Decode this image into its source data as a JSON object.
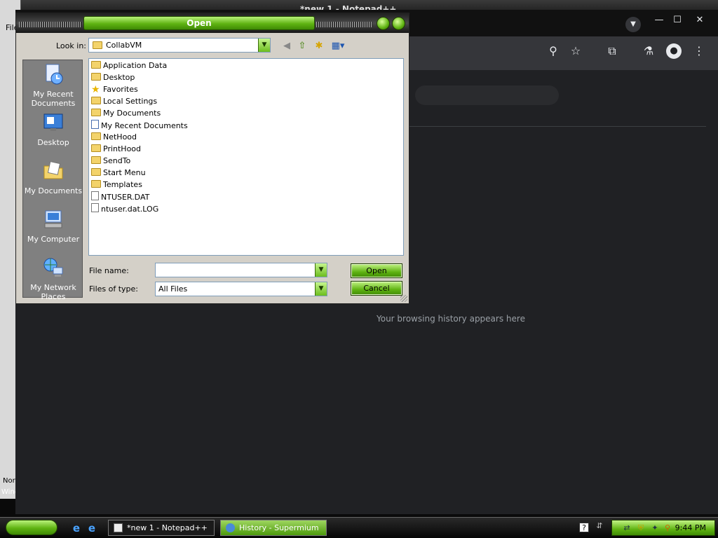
{
  "notepad": {
    "title": "*new 1 - Notepad++",
    "menu_label": "File",
    "status_left": "Nor",
    "status_left2": "Wind"
  },
  "browser": {
    "empty_history_text": "Your browsing history appears here"
  },
  "dialog": {
    "title": "Open",
    "look_in_label": "Look in:",
    "look_in_value": "CollabVM",
    "places": [
      {
        "label": "My Recent Documents"
      },
      {
        "label": "Desktop"
      },
      {
        "label": "My Documents"
      },
      {
        "label": "My Computer"
      },
      {
        "label": "My Network Places"
      }
    ],
    "files": [
      {
        "name": "Application Data",
        "type": "folder"
      },
      {
        "name": "Desktop",
        "type": "folder"
      },
      {
        "name": "Favorites",
        "type": "favorites"
      },
      {
        "name": "Local Settings",
        "type": "folder"
      },
      {
        "name": "My Documents",
        "type": "folder"
      },
      {
        "name": "My Recent Documents",
        "type": "recent"
      },
      {
        "name": "NetHood",
        "type": "folder"
      },
      {
        "name": "PrintHood",
        "type": "folder"
      },
      {
        "name": "SendTo",
        "type": "folder"
      },
      {
        "name": "Start Menu",
        "type": "folder"
      },
      {
        "name": "Templates",
        "type": "folder"
      },
      {
        "name": "NTUSER.DAT",
        "type": "file"
      },
      {
        "name": "ntuser.dat.LOG",
        "type": "file"
      }
    ],
    "file_name_label": "File name:",
    "file_name_value": "",
    "files_of_type_label": "Files of type:",
    "files_of_type_value": "All Files",
    "open_label": "Open",
    "cancel_label": "Cancel"
  },
  "taskbar": {
    "tasks": [
      {
        "label": "*new 1 - Notepad++"
      },
      {
        "label": "History - Supermium"
      }
    ],
    "clock": "9:44 PM"
  },
  "colors": {
    "accent_green": "#5fb312",
    "browser_bg": "#202124",
    "dialog_bg": "#d4d0c8"
  }
}
